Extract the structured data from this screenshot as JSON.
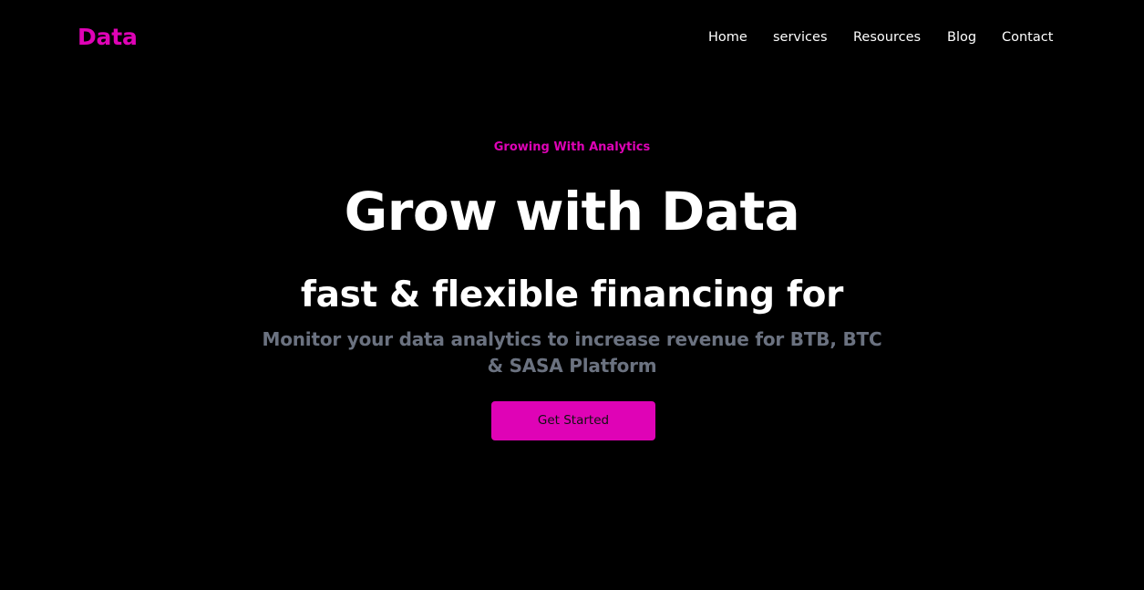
{
  "brand": {
    "logo_text": "Data"
  },
  "nav": {
    "items": [
      {
        "label": "Home"
      },
      {
        "label": "services"
      },
      {
        "label": "Resources"
      },
      {
        "label": "Blog"
      },
      {
        "label": "Contact"
      }
    ]
  },
  "hero": {
    "eyebrow": "Growing With Analytics",
    "headline": "Grow with Data",
    "subheadline": "fast & flexible financing for",
    "description": "Monitor your data analytics to increase revenue for BTB, BTC & SASA Platform",
    "cta_label": "Get Started"
  },
  "colors": {
    "background": "#000000",
    "accent": "#df03b6",
    "heading_text": "#ffffff",
    "muted_text": "#6b7280",
    "button_text": "#111111"
  }
}
